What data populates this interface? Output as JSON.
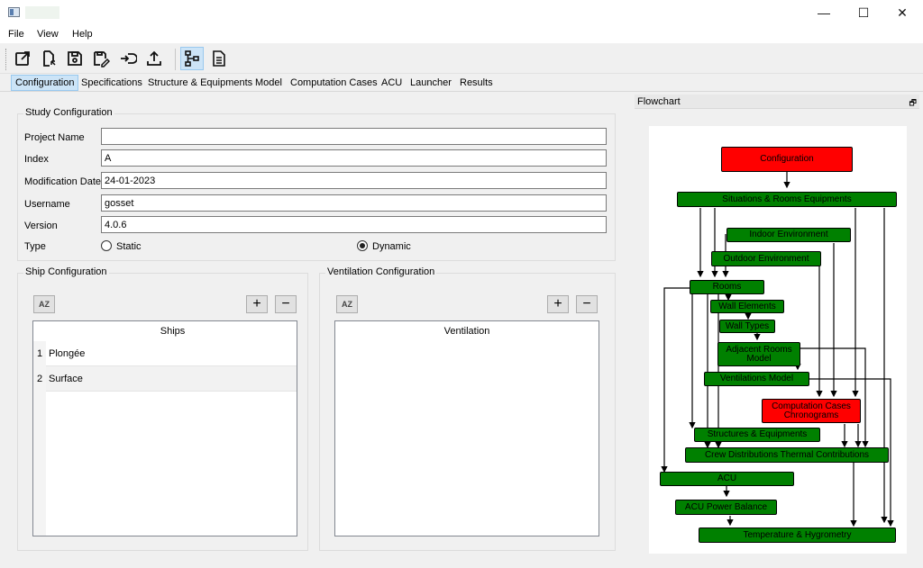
{
  "window": {
    "controls": {
      "minimize": "—",
      "maximize": "☐",
      "close": "✕"
    }
  },
  "menu": {
    "file": "File",
    "view": "View",
    "help": "Help"
  },
  "toolbar": {
    "icons": [
      "new-window-icon",
      "open-file-icon",
      "save-icon",
      "save-as-icon",
      "import-icon",
      "export-icon",
      "flowchart-icon",
      "report-icon"
    ]
  },
  "tabs": [
    "Configuration",
    "Specifications",
    "Structure & Equipments",
    "Model",
    "Computation Cases",
    "ACU",
    "Launcher",
    "Results"
  ],
  "study": {
    "title": "Study Configuration",
    "fields": [
      {
        "label": "Project Name",
        "value": ""
      },
      {
        "label": "Index",
        "value": "A"
      },
      {
        "label": "Modification Date",
        "value": "24-01-2023"
      },
      {
        "label": "Username",
        "value": "gosset"
      },
      {
        "label": "Version",
        "value": "4.0.6"
      }
    ],
    "type_label": "Type",
    "type_options": [
      {
        "label": "Static",
        "checked": false
      },
      {
        "label": "Dynamic",
        "checked": true
      }
    ]
  },
  "ship": {
    "title": "Ship Configuration",
    "sort_label": "AZ",
    "add": "+",
    "remove": "−",
    "header": "Ships",
    "rows": [
      {
        "num": "1",
        "name": "Plongée"
      },
      {
        "num": "2",
        "name": "Surface"
      }
    ]
  },
  "ventilation": {
    "title": "Ventilation Configuration",
    "sort_label": "AZ",
    "add": "+",
    "remove": "−",
    "header": "Ventilation"
  },
  "flowchart": {
    "title": "Flowchart",
    "float_icon": "🗗",
    "colors": {
      "green": "#008000",
      "red": "#ff0000"
    },
    "nodes": {
      "configuration": "Configuration",
      "situations": "Situations & Rooms Equipments",
      "indoor": "Indoor Environment",
      "outdoor": "Outdoor Environment",
      "rooms": "Rooms",
      "wall_elements": "Wall Elements",
      "wall_types": "Wall Types",
      "adjacent_1": "Adjacent Rooms",
      "adjacent_2": "Model",
      "ventilations": "Ventilations Model",
      "computation_1": "Computation Cases",
      "computation_2": "Chronograms",
      "structures": "Structures & Equipments",
      "crew": "Crew Distributions Thermal Contributions",
      "acu": "ACU",
      "acu_power": "ACU Power Balance",
      "temperature": "Temperature & Hygrometry"
    }
  }
}
